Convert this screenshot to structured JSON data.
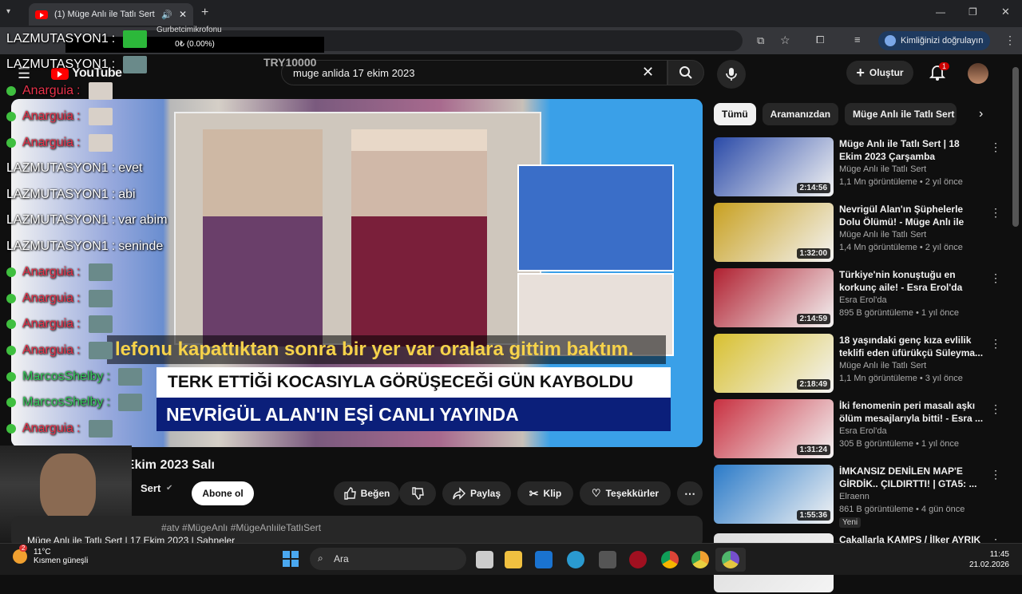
{
  "browser": {
    "tab_title": "(1) Müge Anlı ile Tatlı Sert |",
    "verify_label": "Kimliğinizi doğrulayın"
  },
  "youtube": {
    "logo": "YouTube",
    "search_value": "muge anlida 17 ekim 2023",
    "create_label": "Oluştur",
    "notif_count": "1"
  },
  "overlay": {
    "top_user": "Gurbetcimikrofonu",
    "donation": "0₺ (0.00%)",
    "goal": "TRY10000",
    "chat": [
      {
        "user": "LAZMUTASYON1",
        "msg": "",
        "color": "lz",
        "check": false,
        "thumb": "green"
      },
      {
        "user": "LAZMUTASYON1",
        "msg": "",
        "color": "lz",
        "check": false,
        "thumb": "face"
      },
      {
        "user": "Anarguia",
        "msg": "",
        "color": "an",
        "check": true,
        "thumb": "cat"
      },
      {
        "user": "Anarguia",
        "msg": "",
        "color": "an",
        "check": true,
        "thumb": "cat"
      },
      {
        "user": "Anarguia",
        "msg": "",
        "color": "an",
        "check": true,
        "thumb": "cat"
      },
      {
        "user": "LAZMUTASYON1",
        "msg": "evet",
        "color": "lz",
        "check": false
      },
      {
        "user": "LAZMUTASYON1",
        "msg": "abi",
        "color": "lz",
        "check": false
      },
      {
        "user": "LAZMUTASYON1",
        "msg": "var abim",
        "color": "lz",
        "check": false
      },
      {
        "user": "LAZMUTASYON1",
        "msg": "seninde",
        "color": "lz",
        "check": false
      },
      {
        "user": "Anarguia",
        "msg": "",
        "color": "an",
        "check": true,
        "thumb": "face"
      },
      {
        "user": "Anarguia",
        "msg": "",
        "color": "an",
        "check": true,
        "thumb": "face"
      },
      {
        "user": "Anarguia",
        "msg": "",
        "color": "an",
        "check": true,
        "thumb": "face"
      },
      {
        "user": "Anarguia",
        "msg": "",
        "color": "an",
        "check": true,
        "thumb": "face"
      },
      {
        "user": "MarcosShelby",
        "msg": "",
        "color": "ms",
        "check": true,
        "thumb": "face"
      },
      {
        "user": "MarcosShelby",
        "msg": "",
        "color": "ms",
        "check": true,
        "thumb": "face"
      },
      {
        "user": "Anarguia",
        "msg": "",
        "color": "an",
        "check": true,
        "thumb": "face"
      }
    ]
  },
  "video": {
    "subtitle": "lefonu kapattıktan sonra bir yer var oralara gittim baktım.",
    "lower1": "TERK ETTİĞİ KOCASIYLA GÖRÜŞECEĞİ GÜN KAYBOLDU",
    "lower2": "NEVRİGÜL ALAN'IN EŞİ CANLI YAYINDA",
    "title": "Mü... Tatlı Sert | 17 Ekim 2023 Salı",
    "channel": "Sert",
    "subscribe": "Abone ol",
    "like": "Beğen",
    "share": "Paylaş",
    "clip": "Klip",
    "thanks": "Teşekkürler",
    "desc_tags": "#atv #MügeAnlı #MügeAnlıileTatlıSert",
    "desc_line": "Müge Anlı ile Tatlı Sert | 17 Ekim 2023 | Sahneler"
  },
  "chips": [
    "Tümü",
    "Aramanızdan",
    "Müge Anlı ile Tatlı Sert a"
  ],
  "recommendations": [
    {
      "title": "Müge Anlı ile Tatlı Sert | 18 Ekim 2023 Çarşamba",
      "channel": "Müge Anlı ile Tatlı Sert",
      "meta": "1,1 Mn görüntüleme • 2 yıl önce",
      "duration": "2:14:56",
      "color": "#2a4aa8"
    },
    {
      "title": "Nevrigül Alan'ın Şüphelerle Dolu Ölümü! - Müge Anlı ile Tatlı Se...",
      "channel": "Müge Anlı ile Tatlı Sert",
      "meta": "1,4 Mn görüntüleme • 2 yıl önce",
      "duration": "1:32:00",
      "color": "#c8a020"
    },
    {
      "title": "Türkiye'nin konuştuğu en korkunç aile! - Esra Erol'da Kolaj",
      "channel": "Esra Erol'da",
      "meta": "895 B görüntüleme • 1 yıl önce",
      "duration": "2:14:59",
      "color": "#b02030"
    },
    {
      "title": "18 yaşındaki genç kıza evlilik teklifi eden üfürükçü Süleyma...",
      "channel": "Müge Anlı ile Tatlı Sert",
      "meta": "1,1 Mn görüntüleme • 3 yıl önce",
      "duration": "2:18:49",
      "color": "#d8c030"
    },
    {
      "title": "İki fenomenin peri masalı aşkı ölüm mesajlarıyla bitti! - Esra ...",
      "channel": "Esra Erol'da",
      "meta": "305 B görüntüleme • 1 yıl önce",
      "duration": "1:31:24",
      "color": "#c83040"
    },
    {
      "title": "İMKANSIZ DENİLEN MAP'E GİRDİK.. ÇILDIRTTI! | GTA5: ...",
      "channel": "Elraenn",
      "meta": "861 B görüntüleme • 4 gün önce",
      "duration": "1:55:36",
      "color": "#2a7ac8",
      "new": "Yeni"
    },
    {
      "title": "Çakallarla KAMPS / İlker AYRIK",
      "channel": "",
      "meta": "",
      "duration": "",
      "color": "#ddd"
    }
  ],
  "taskbar": {
    "temp": "11°C",
    "weather": "Kısmen güneşli",
    "search": "Ara",
    "time": "11:45",
    "date": "21.02.2026",
    "badge": "2"
  }
}
